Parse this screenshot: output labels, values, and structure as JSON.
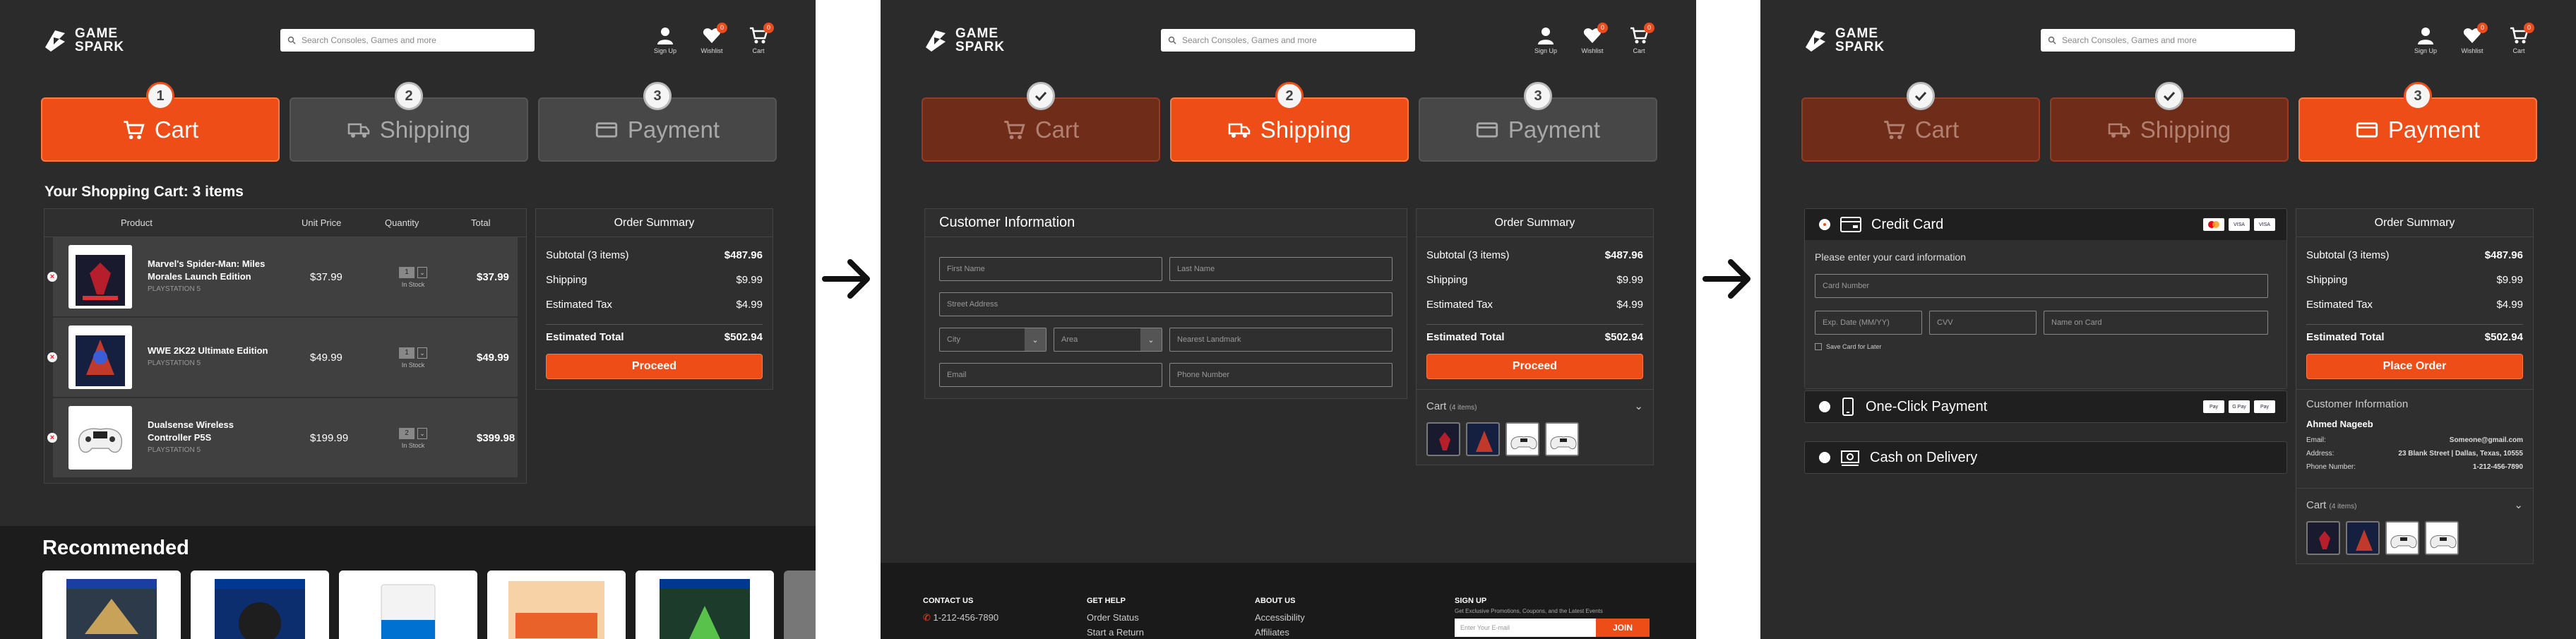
{
  "header": {
    "logo_line1": "GAME",
    "logo_line2": "SPARK",
    "search_placeholder": "Search Consoles, Games and more",
    "signup_label": "Sign Up",
    "wishlist_label": "Wishlist",
    "wishlist_count": "0",
    "cart_label": "Cart",
    "cart_count": "0"
  },
  "steps": [
    {
      "num": "1",
      "label": "Cart"
    },
    {
      "num": "2",
      "label": "Shipping"
    },
    {
      "num": "3",
      "label": "Payment"
    }
  ],
  "cart_page": {
    "title": "Your Shopping Cart: 3 items",
    "columns": [
      "Product",
      "Unit Price",
      "Quantity",
      "Total"
    ],
    "items": [
      {
        "name": "Marvel's Spider-Man: Miles Morales Launch Edition",
        "platform": "PLAYSTATION 5",
        "price": "$37.99",
        "qty": "1",
        "stock": "In Stock",
        "total": "$37.99"
      },
      {
        "name": "WWE 2K22 Ultimate Edition",
        "platform": "PLAYSTATION 5",
        "price": "$49.99",
        "qty": "1",
        "stock": "In Stock",
        "total": "$49.99"
      },
      {
        "name": "Dualsense Wireless Controller P5S",
        "platform": "PLAYSTATION 5",
        "price": "$199.99",
        "qty": "2",
        "stock": "In Stock",
        "total": "$399.98"
      }
    ],
    "recommended_title": "Recommended"
  },
  "order_summary": {
    "title": "Order Summary",
    "subtotal_label": "Subtotal (3 items)",
    "subtotal": "$487.96",
    "shipping_label": "Shipping",
    "shipping": "$9.99",
    "tax_label": "Estimated Tax",
    "tax": "$4.99",
    "total_label": "Estimated Total",
    "total": "$502.94",
    "proceed": "Proceed",
    "place_order": "Place Order"
  },
  "shipping_page": {
    "title": "Customer Information",
    "first_name": "First Name",
    "last_name": "Last Name",
    "street": "Street Address",
    "city": "City",
    "area": "Area",
    "landmark": "Nearest Landmark",
    "email": "Email",
    "phone": "Phone Number",
    "cart_label": "Cart",
    "cart_count": "(4 items)"
  },
  "footer": {
    "contact_title": "CONTACT US",
    "contact_phone": "1-212-456-7890",
    "help_title": "GET HELP",
    "help_1": "Order Status",
    "help_2": "Start a Return",
    "about_title": "ABOUT US",
    "about_1": "Accessibility",
    "about_2": "Affiliates",
    "signup_title": "SIGN UP",
    "signup_text": "Get Exclusive Promotions, Coupons, and the Latest Events",
    "email_placeholder": "Enter Your E-mail",
    "join": "JOIN"
  },
  "payment_page": {
    "credit_card": "Credit Card",
    "card_prompt": "Please enter your card information",
    "card_number": "Card Number",
    "exp_date": "Exp. Date (MM/YY)",
    "cvv": "CVV",
    "name_on_card": "Name on Card",
    "save_card": "Save Card for Later",
    "one_click": "One-Click Payment",
    "cod": "Cash on Delivery",
    "customer_title": "Customer Information",
    "customer_name": "Ahmed Nageeb",
    "email_label": "Email:",
    "email": "Someone@gmail.com",
    "address_label": "Address:",
    "address": "23 Blank Street | Dallas, Texas, 10555",
    "phone_label": "Phone Number:",
    "phone": "1-212-456-7890",
    "cart_label": "Cart",
    "cart_count": "(4 items)"
  }
}
